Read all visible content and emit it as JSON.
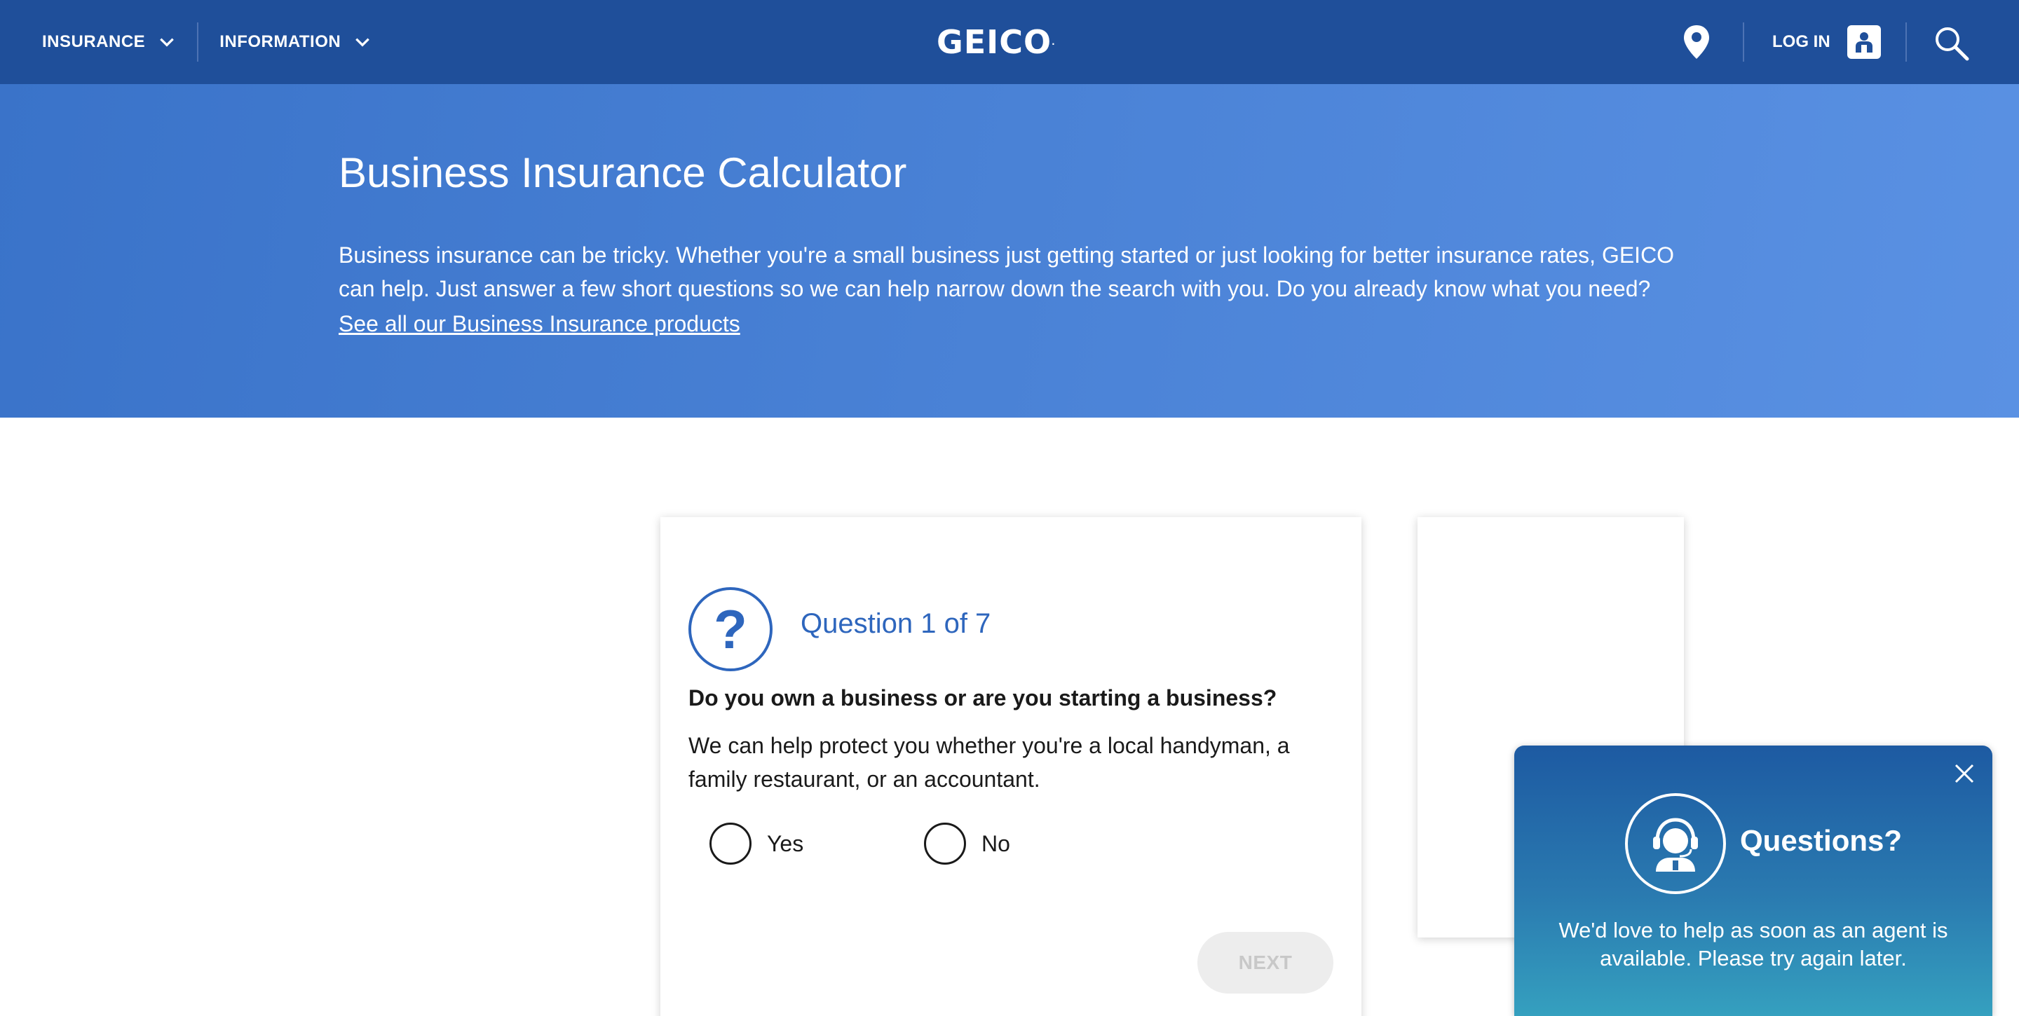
{
  "nav": {
    "insurance_label": "INSURANCE",
    "information_label": "INFORMATION",
    "logo_text": "GEICO",
    "logo_mark": ".",
    "login_label": "LOG IN",
    "icons": [
      "chevron-down-icon",
      "location-pin-icon",
      "user-icon",
      "search-icon"
    ]
  },
  "hero": {
    "title": "Business Insurance Calculator",
    "description": "Business insurance can be tricky. Whether you're a small business just getting started or just looking for better insurance rates, GEICO can help. Just answer a few short questions so we can help narrow down the search with you. Do you already know what you need?",
    "link_text": "See all our Business Insurance products"
  },
  "question": {
    "icon_glyph": "?",
    "number": "Question 1 of 7",
    "title": "Do you own a business or are you starting a business?",
    "description": "We can help protect you whether you're a local handyman, a family restaurant, or an accountant.",
    "options": [
      {
        "label": "Yes"
      },
      {
        "label": "No"
      }
    ],
    "next_label": "NEXT"
  },
  "chat": {
    "title": "Questions?",
    "message": "We'd love to help as soon as an agent is available. Please try again later."
  },
  "colors": {
    "nav_bg": "#1f4f9a",
    "hero_bg": "#4a82d6",
    "accent": "#2e66bd",
    "chat_top": "#1d5aa2",
    "chat_bottom": "#35a0bf"
  }
}
